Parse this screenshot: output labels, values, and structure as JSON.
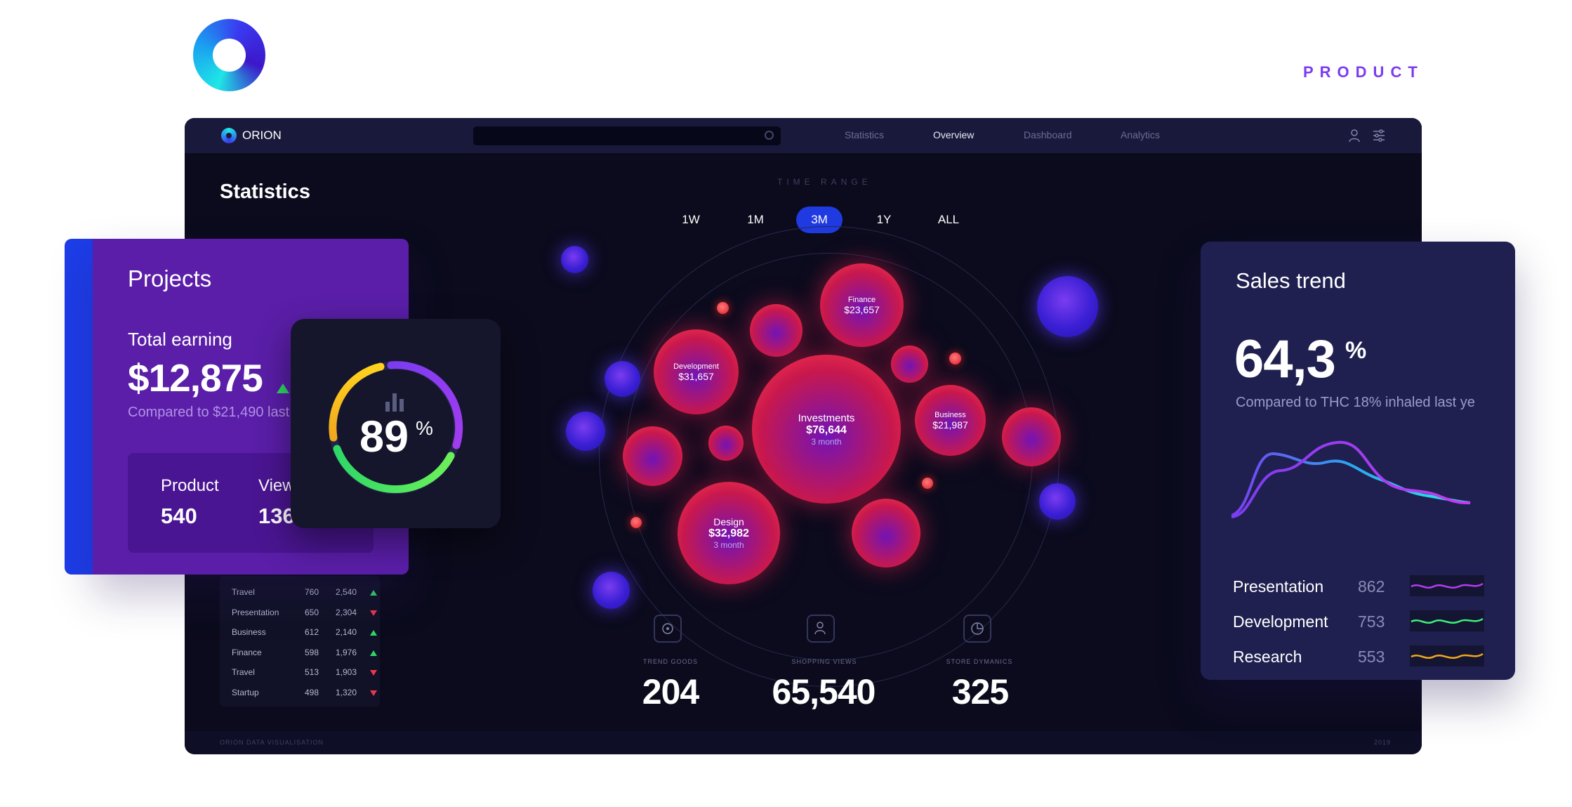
{
  "brand": {
    "product_tag": "PRODUCT",
    "app_name": "ORION"
  },
  "nav": {
    "items": [
      "Statistics",
      "Overview",
      "Dashboard",
      "Analytics"
    ],
    "active": "Overview"
  },
  "page": {
    "title": "Statistics"
  },
  "time_range": {
    "label": "TIME RANGE",
    "options": [
      "1W",
      "1M",
      "3M",
      "1Y",
      "ALL"
    ],
    "selected": "3M"
  },
  "bubbles": {
    "finance": {
      "name": "Finance",
      "value": "$23,657"
    },
    "development": {
      "name": "Development",
      "value": "$31,657"
    },
    "investments": {
      "name": "Investments",
      "value": "$76,644",
      "period": "3 month"
    },
    "business": {
      "name": "Business",
      "value": "$21,987"
    },
    "design": {
      "name": "Design",
      "value": "$32,982",
      "period": "3 month"
    }
  },
  "kpis": [
    {
      "label": "TREND GOODS",
      "value": "204"
    },
    {
      "label": "SHOPPING VIEWS",
      "value": "65,540"
    },
    {
      "label": "STORE DYMANICS",
      "value": "325"
    }
  ],
  "table": {
    "rows": [
      {
        "name": "Travel",
        "a": "760",
        "b": "2,540",
        "trend": "up"
      },
      {
        "name": "Presentation",
        "a": "650",
        "b": "2,304",
        "trend": "down"
      },
      {
        "name": "Business",
        "a": "612",
        "b": "2,140",
        "trend": "up"
      },
      {
        "name": "Finance",
        "a": "598",
        "b": "1,976",
        "trend": "up"
      },
      {
        "name": "Travel",
        "a": "513",
        "b": "1,903",
        "trend": "down"
      },
      {
        "name": "Startup",
        "a": "498",
        "b": "1,320",
        "trend": "down"
      }
    ]
  },
  "footer": {
    "left": "ORION DATA VISUALISATION",
    "right": "2019"
  },
  "projects": {
    "title": "Projects",
    "subtitle": "Total earning",
    "amount": "$12,875",
    "compare": "Compared to $21,490 last",
    "product_label": "Product",
    "product_value": "540",
    "views_label": "View",
    "views_value": "136"
  },
  "gauge": {
    "value": "89",
    "unit": "%",
    "fill": 0.89
  },
  "sales": {
    "title": "Sales trend",
    "value": "64,3",
    "unit": "%",
    "compare": "Compared to THC 18% inhaled last ye",
    "rows": [
      {
        "label": "Presentation",
        "value": "862",
        "color": "#b43cf0"
      },
      {
        "label": "Development",
        "value": "753",
        "color": "#3ef07a"
      },
      {
        "label": "Research",
        "value": "553",
        "color": "#f0a81e"
      }
    ]
  },
  "colors": {
    "accent": "#7b3cf0",
    "selected": "#1f3ae0",
    "up": "#2ed866",
    "down": "#f0364a"
  }
}
